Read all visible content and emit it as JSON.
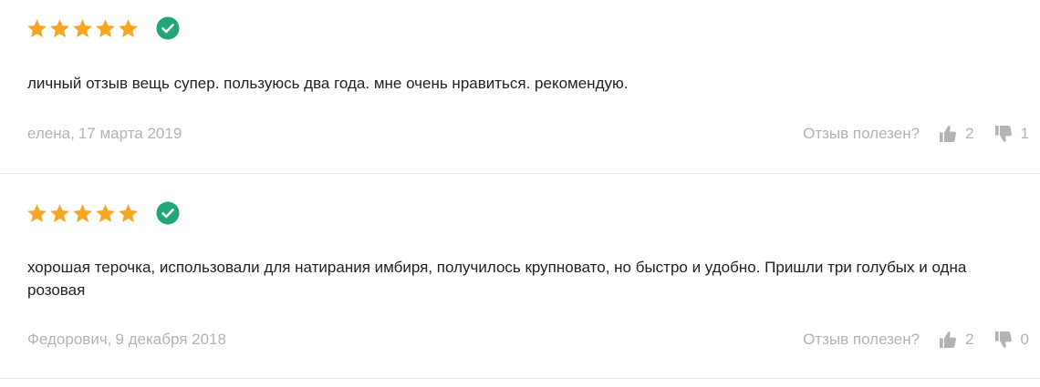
{
  "colors": {
    "star": "#f5a623",
    "verified": "#21a67a",
    "muted_text": "#b3b3b3",
    "body_text": "#222222",
    "divider": "#e6e6e6"
  },
  "icons": {
    "star": "star-icon",
    "verified": "check-circle-icon",
    "like": "thumbs-up-icon",
    "dislike": "thumbs-down-icon"
  },
  "reviews": [
    {
      "rating": 5,
      "verified": true,
      "text": "личный отзыв вещь супер. пользуюсь два года. мне очень нравиться. рекомендую.",
      "author": "елена,",
      "date": "17 марта 2019",
      "helpful_label": "Отзыв полезен?",
      "likes": "2",
      "dislikes": "1"
    },
    {
      "rating": 5,
      "verified": true,
      "text": "хорошая терочка, использовали для натирания имбиря, получилось крупновато, но быстро и удобно. Пришли три голубых и одна розовая",
      "author": "Федорович,",
      "date": "9 декабря 2018",
      "helpful_label": "Отзыв полезен?",
      "likes": "2",
      "dislikes": "0"
    }
  ]
}
